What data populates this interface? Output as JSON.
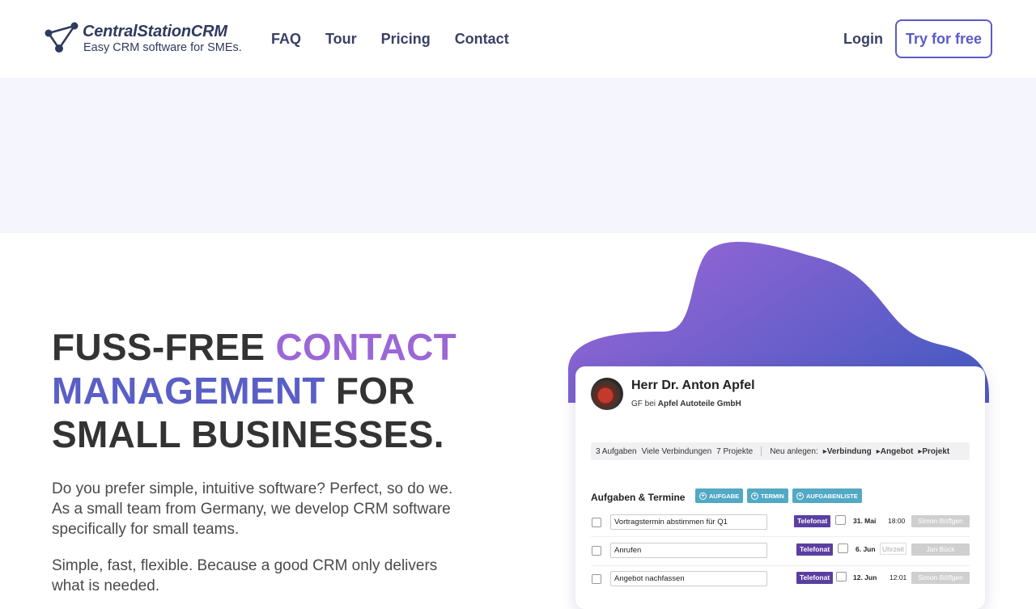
{
  "header": {
    "logo_name": "CentralStationCRM",
    "logo_tagline": "Easy CRM software for SMEs.",
    "nav": [
      "FAQ",
      "Tour",
      "Pricing",
      "Contact"
    ],
    "login": "Login",
    "cta": "Try for free"
  },
  "hero": {
    "headline_a": "FUSS-FREE ",
    "headline_b": "CONTACT",
    "headline_c": "MANAGEMENT",
    "headline_d": " FOR",
    "headline_e": "SMALL BUSINESSES.",
    "para1": "Do you prefer simple, intuitive software? Perfect, so do we. As a small team from Germany, we develop CRM software specifically for small teams.",
    "para2": "Simple, fast, flexible. Because a good CRM only delivers what is needed.",
    "colors": {
      "purple": "#9b67d6",
      "indigo": "#5a5fc6"
    }
  },
  "card": {
    "name": "Herr Dr. Anton Apfel",
    "role": "GF bei",
    "company": "Apfel Autoteile GmbH",
    "info": [
      "3 Aufgaben",
      "Viele Verbindungen",
      "7 Projekte"
    ],
    "new_label": "Neu anlegen:",
    "new_links": [
      "Verbindung",
      "Angebot",
      "Projekt"
    ],
    "section_title": "Aufgaben & Termine",
    "chips": [
      "AUFGABE",
      "TERMIN",
      "AUFGABENLISTE"
    ],
    "tasks": [
      {
        "title": "Vortragstermin abstimmen für Q1",
        "type": "Telefonat",
        "date": "31. Mai",
        "time": "18:00",
        "person": "Simon Böffgen"
      },
      {
        "title": "Anrufen",
        "type": "Telefonat",
        "date": "6. Jun",
        "time": "Uhrzeit",
        "person": "Jan Bück"
      },
      {
        "title": "Angebot nachfassen",
        "type": "Telefonat",
        "date": "12. Jun",
        "time": "12:01",
        "person": "Simon Böffgen"
      }
    ]
  }
}
